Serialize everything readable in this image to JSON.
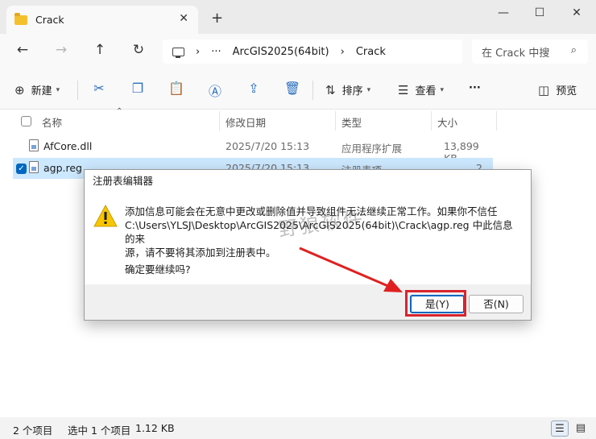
{
  "window": {
    "tab_title": "Crack",
    "tab_close": "✕",
    "new_tab": "+",
    "minimize": "—",
    "maximize": "☐",
    "close": "✕"
  },
  "address": {
    "more": "···",
    "sep1": "›",
    "crumb1": "ArcGIS2025(64bit)",
    "sep2": "›",
    "crumb2": "Crack",
    "search_placeholder": "在 Crack 中搜"
  },
  "toolbar": {
    "new_label": "新建",
    "sort_label": "排序",
    "view_label": "查看",
    "more_label": "···",
    "preview_label": "预览"
  },
  "columns": {
    "name": "名称",
    "modified": "修改日期",
    "type": "类型",
    "size": "大小"
  },
  "files": [
    {
      "name": "AfCore.dll",
      "modified": "2025/7/20 15:13",
      "type": "应用程序扩展",
      "size": "13,899 KB"
    },
    {
      "name": "agp.reg",
      "modified": "2025/7/20 15:13",
      "type": "注册表项",
      "size": "2 KB"
    }
  ],
  "status": {
    "count": "2 个项目",
    "selected": "选中 1 个项目",
    "size": "1.12 KB"
  },
  "dialog": {
    "title": "注册表编辑器",
    "line1": "添加信息可能会在无意中更改或删除值并导致组件无法继续正常工作。如果你不信任",
    "line2": "C:\\Users\\YLSJ\\Desktop\\ArcGIS2025\\ArcGIS2025(64bit)\\Crack\\agp.reg 中此信息的来",
    "line3": "源，请不要将其添加到注册表中。",
    "question": "确定要继续吗?",
    "yes_label": "是(Y)",
    "no_label": "否(N)"
  },
  "watermark": "野狼软件",
  "colors": {
    "accent": "#0067c0",
    "highlight": "#d9242c",
    "selected_row": "#cce8ff"
  }
}
